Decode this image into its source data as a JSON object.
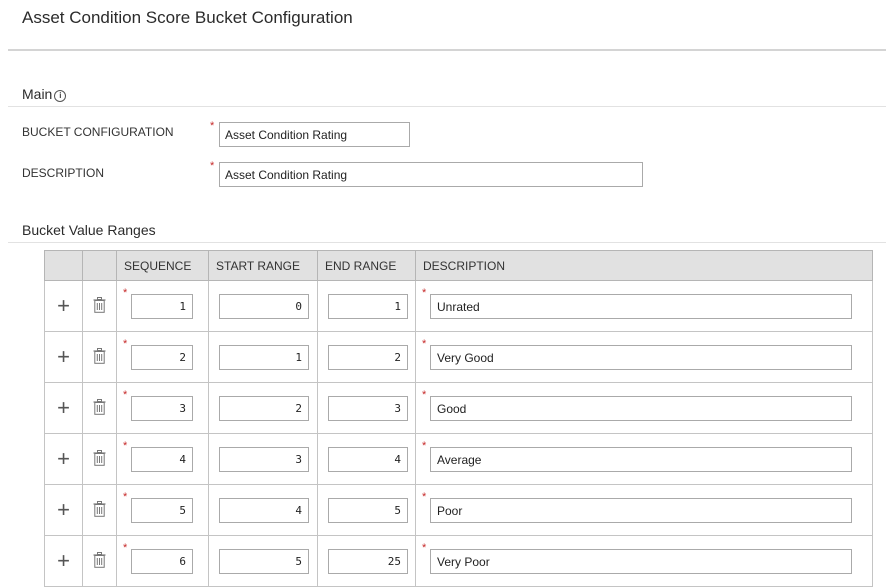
{
  "page_title": "Asset Condition Score Bucket Configuration",
  "main_section": {
    "heading": "Main",
    "info_icon": "info-icon",
    "fields": {
      "bucket_configuration": {
        "label": "BUCKET CONFIGURATION",
        "value": "Asset Condition Rating",
        "required": true
      },
      "description": {
        "label": "DESCRIPTION",
        "value": "Asset Condition Rating",
        "required": true
      }
    }
  },
  "ranges_section": {
    "heading": "Bucket Value Ranges",
    "columns": [
      "",
      "",
      "SEQUENCE",
      "START RANGE",
      "END RANGE",
      "DESCRIPTION"
    ],
    "rows": [
      {
        "sequence": "1",
        "start": "0",
        "end": "1",
        "description": "Unrated"
      },
      {
        "sequence": "2",
        "start": "1",
        "end": "2",
        "description": "Very Good"
      },
      {
        "sequence": "3",
        "start": "2",
        "end": "3",
        "description": "Good"
      },
      {
        "sequence": "4",
        "start": "3",
        "end": "4",
        "description": "Average"
      },
      {
        "sequence": "5",
        "start": "4",
        "end": "5",
        "description": "Poor"
      },
      {
        "sequence": "6",
        "start": "5",
        "end": "25",
        "description": "Very Poor"
      }
    ]
  },
  "icons": {
    "add_row": "plus-icon",
    "delete_row": "trash-icon",
    "required": "asterisk"
  },
  "colors": {
    "required_marker": "#c62828",
    "header_bg": "#e1e1e1"
  }
}
